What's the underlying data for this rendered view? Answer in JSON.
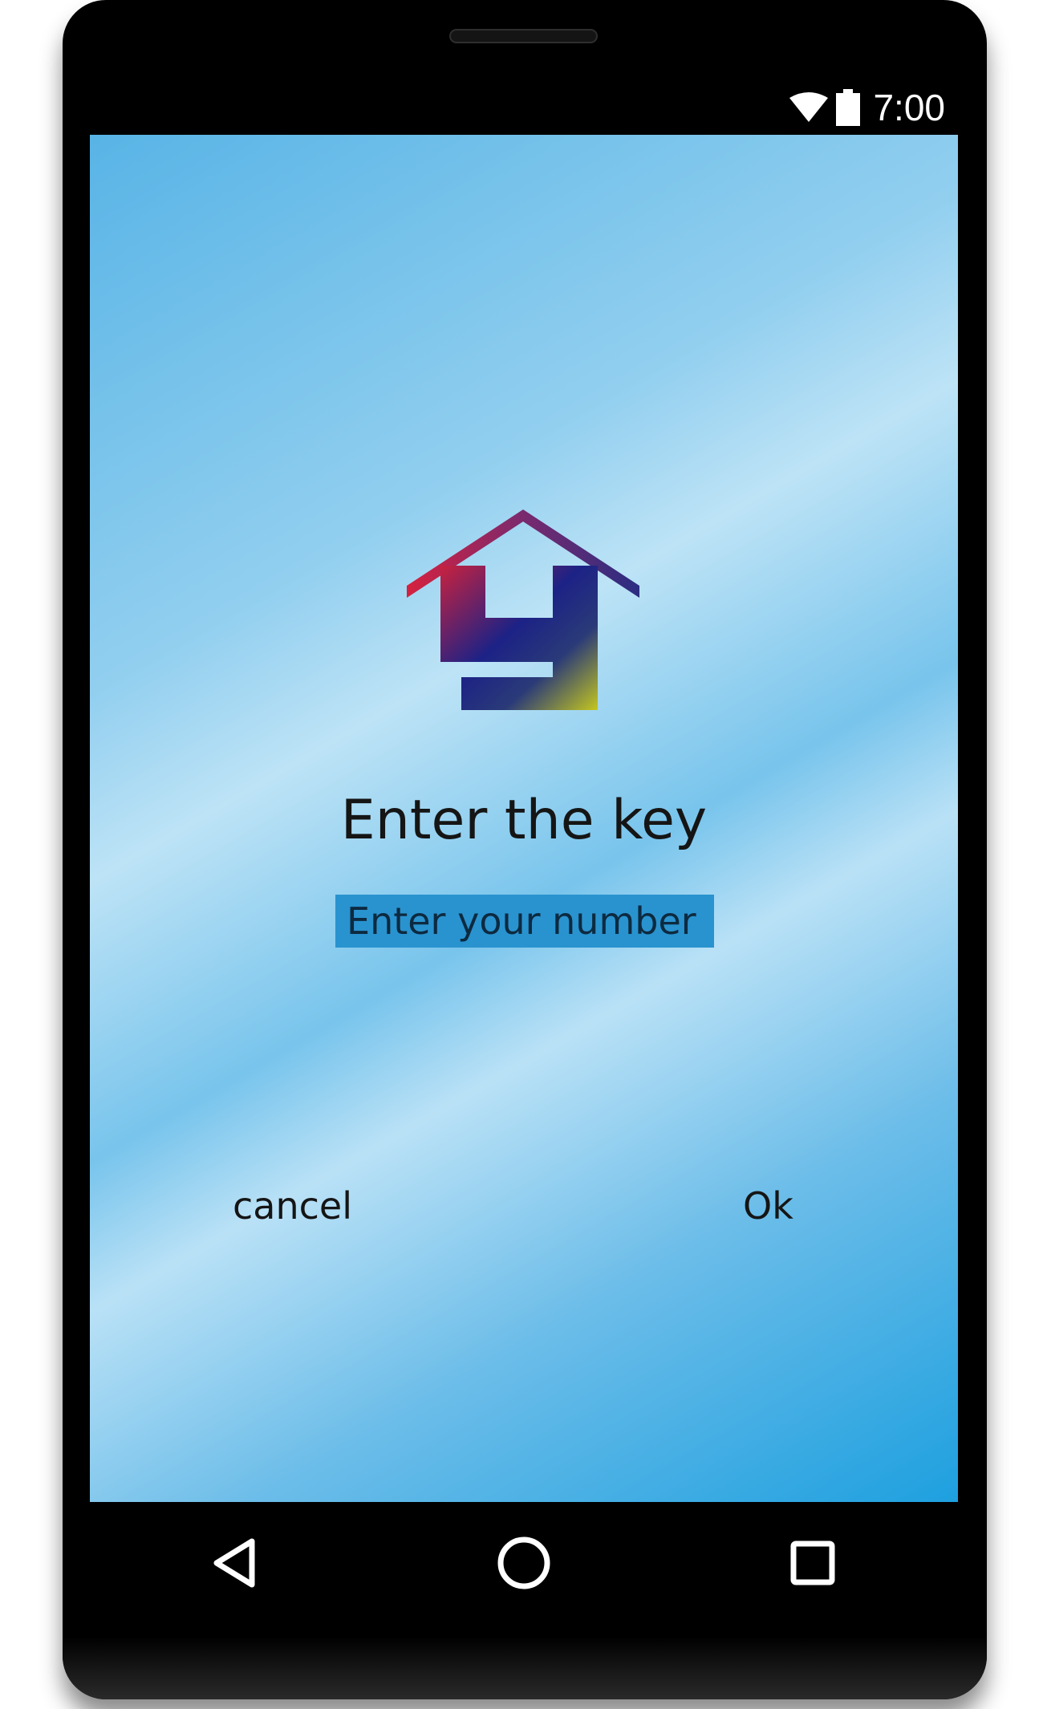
{
  "status_bar": {
    "time": "7:00",
    "icons": [
      "wifi-icon",
      "battery-icon"
    ]
  },
  "dialog": {
    "logo": "house-y-logo",
    "title": "Enter the key",
    "input": {
      "value": "",
      "placeholder": "Enter your number"
    },
    "cancel_label": "cancel",
    "ok_label": "Ok"
  },
  "nav_bar": {
    "icons": [
      "back-icon",
      "home-icon",
      "recents-icon"
    ]
  },
  "colors": {
    "frame": "#000000",
    "input_background": "#2993cf",
    "screen_accent": "#1ea0df",
    "text": "#151515"
  }
}
